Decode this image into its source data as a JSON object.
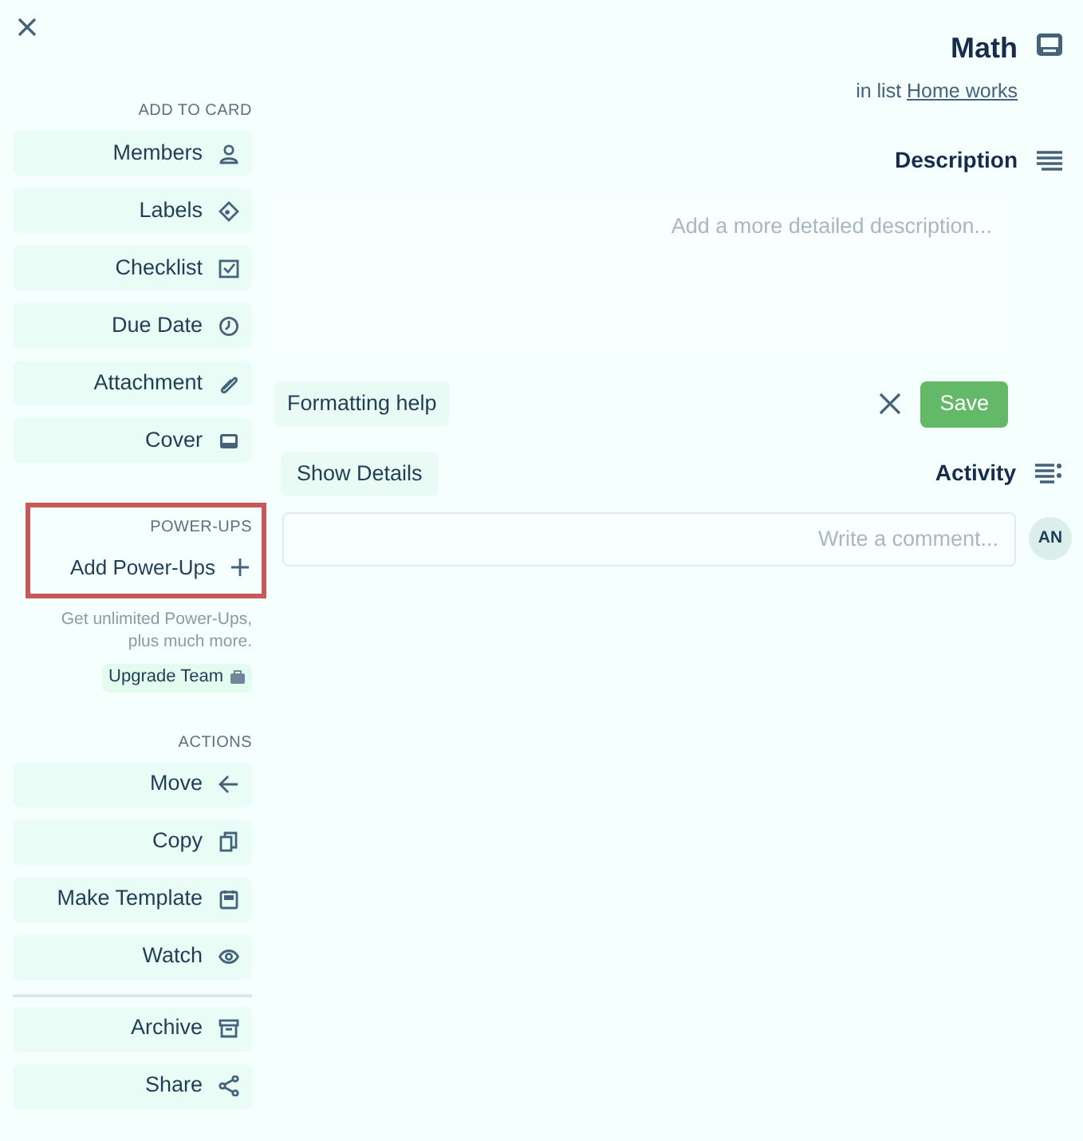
{
  "card": {
    "title": "Math",
    "list_prefix": "in list",
    "list_name": "Home works"
  },
  "description": {
    "heading": "Description",
    "placeholder": "Add a more detailed description...",
    "save": "Save",
    "formatting_help": "Formatting help"
  },
  "activity": {
    "heading": "Activity",
    "show_details": "Show Details",
    "avatar": "AN",
    "comment_placeholder": "Write a comment..."
  },
  "add_to_card": {
    "heading": "ADD TO CARD",
    "items": [
      {
        "label": "Members",
        "kind": "members"
      },
      {
        "label": "Labels",
        "kind": "labels"
      },
      {
        "label": "Checklist",
        "kind": "checklist"
      },
      {
        "label": "Due Date",
        "kind": "due"
      },
      {
        "label": "Attachment",
        "kind": "attachment"
      },
      {
        "label": "Cover",
        "kind": "cover"
      }
    ]
  },
  "power_ups": {
    "heading": "POWER-UPS",
    "add": "Add Power-Ups",
    "note": "Get unlimited Power-Ups, plus much more.",
    "upgrade": "Upgrade Team"
  },
  "actions": {
    "heading": "ACTIONS",
    "items": [
      {
        "label": "Move",
        "kind": "move"
      },
      {
        "label": "Copy",
        "kind": "copy"
      },
      {
        "label": "Make Template",
        "kind": "template"
      },
      {
        "label": "Watch",
        "kind": "watch"
      },
      {
        "label": "Archive",
        "kind": "archive",
        "divider_before": true
      },
      {
        "label": "Share",
        "kind": "share"
      }
    ]
  }
}
